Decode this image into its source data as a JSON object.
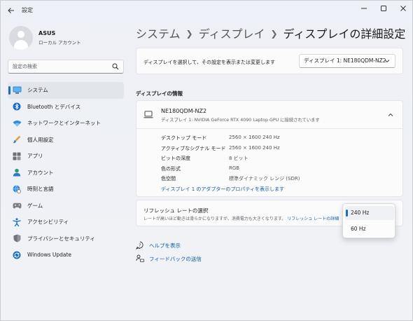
{
  "window": {
    "title": "設定"
  },
  "profile": {
    "name": "ASUS",
    "account_type": "ローカル アカウント"
  },
  "search": {
    "placeholder": "設定の検索"
  },
  "sidebar": {
    "items": [
      {
        "label": "システム",
        "icon": "system-monitor-icon",
        "active": true
      },
      {
        "label": "Bluetooth とデバイス",
        "icon": "bluetooth-icon"
      },
      {
        "label": "ネットワークとインターネット",
        "icon": "wifi-icon"
      },
      {
        "label": "個人用設定",
        "icon": "paintbrush-icon"
      },
      {
        "label": "アプリ",
        "icon": "apps-icon"
      },
      {
        "label": "アカウント",
        "icon": "account-icon"
      },
      {
        "label": "時刻と言語",
        "icon": "globe-clock-icon"
      },
      {
        "label": "ゲーム",
        "icon": "gamepad-icon"
      },
      {
        "label": "アクセシビリティ",
        "icon": "accessibility-icon"
      },
      {
        "label": "プライバシーとセキュリティ",
        "icon": "shield-icon"
      },
      {
        "label": "Windows Update",
        "icon": "windows-update-icon"
      }
    ]
  },
  "breadcrumb": {
    "level1": "システム",
    "level2": "ディスプレイ",
    "current": "ディスプレイの詳細設定"
  },
  "display_select": {
    "label": "ディスプレイを選択して、その設定を表示または変更します",
    "selected": "ディスプレイ 1: NE180QDM-NZ2"
  },
  "display_info": {
    "section_title": "ディスプレイの情報",
    "monitor_name": "NE180QDM-NZ2",
    "monitor_connection": "ディスプレイ 1: NVIDIA GeForce RTX 4090 Laptop GPU に接続されています",
    "rows": [
      {
        "key": "デスクトップ モード",
        "value": "2560 × 1600 240 Hz"
      },
      {
        "key": "アクティブなシグナル モード",
        "value": "2560 × 1600 240 Hz"
      },
      {
        "key": "ビットの深度",
        "value": "8 ビット"
      },
      {
        "key": "色の形式",
        "value": "RGB"
      },
      {
        "key": "色空間",
        "value": "標準ダイナミック レンジ (SDR)"
      }
    ],
    "adapter_link": "ディスプレイ 1 のアダプターのプロパティを表示します"
  },
  "refresh_rate": {
    "title": "リフレッシュ レートの選択",
    "description": "レートが高いほど動きは滑らかになりますが、消費電力も大きくなります。",
    "link": "リフレッシュ レートの詳細",
    "options": [
      "240 Hz",
      "60 Hz"
    ],
    "selected": "240 Hz"
  },
  "help": {
    "get_help": "ヘルプを表示",
    "feedback": "フィードバックの送信"
  },
  "colors": {
    "accent": "#1a6ec4",
    "link": "#0b5cad"
  }
}
